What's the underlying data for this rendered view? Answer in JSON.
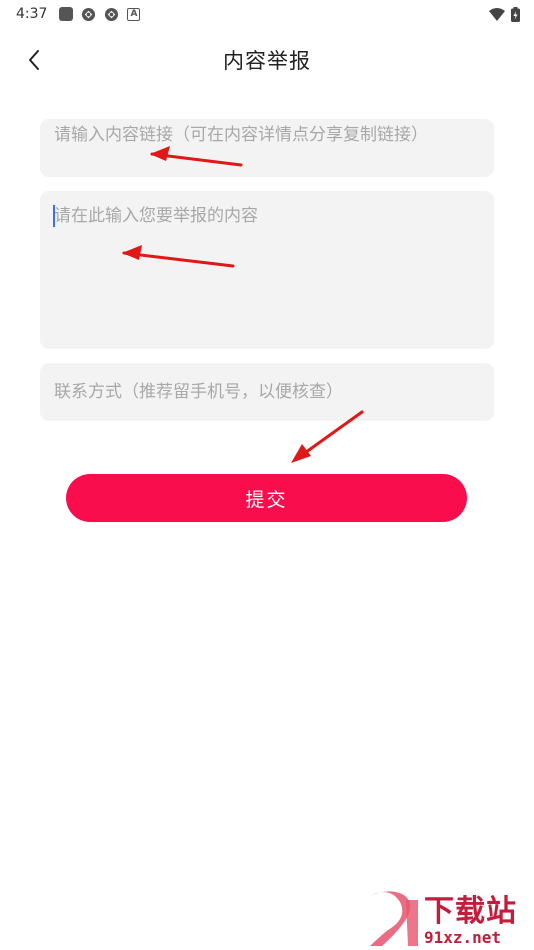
{
  "status_bar": {
    "time": "4:37"
  },
  "header": {
    "title": "内容举报",
    "back_icon": "chevron-left-icon"
  },
  "form": {
    "link_placeholder": "请输入内容链接（可在内容详情点分享复制链接）",
    "content_placeholder": "请在此输入您要举报的内容",
    "contact_placeholder": "联系方式（推荐留手机号，以便核查）",
    "submit_label": "提交"
  },
  "colors": {
    "accent": "#fa0d4c",
    "field_bg": "#f3f3f3",
    "annotation_arrow": "#e01818"
  },
  "watermark": {
    "chinese": "下载站",
    "domain": "91xz.net"
  }
}
